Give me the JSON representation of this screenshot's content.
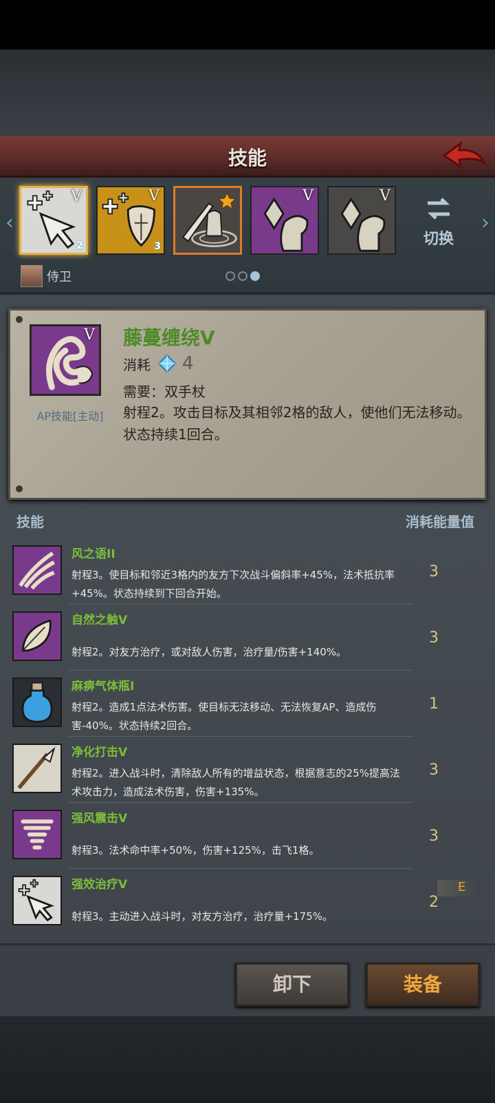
{
  "header": {
    "title": "技能"
  },
  "skillbar": {
    "slots": [
      {
        "roman": "V",
        "level": "2"
      },
      {
        "roman": "V",
        "level": "3"
      },
      {
        "roman": ""
      },
      {
        "roman": "V"
      },
      {
        "roman": "V"
      }
    ],
    "switch_label": "切换",
    "guard_label": "侍卫"
  },
  "detail": {
    "name": "藤蔓缠绕V",
    "roman": "V",
    "type": "AP技能[主动]",
    "cost_label": "消耗",
    "cost_value": "4",
    "requirement": "需要：双手杖",
    "description": "射程2。攻击目标及其相邻2格的敌人，使他们无法移动。状态持续1回合。"
  },
  "list": {
    "header_skill": "技能",
    "header_cost": "消耗能量值",
    "items": [
      {
        "name": "风之语II",
        "desc": "射程3。使目标和邻近3格内的友方下次战斗偏斜率+45%，法术抵抗率+45%。状态持续到下回合开始。",
        "cost": "3"
      },
      {
        "name": "自然之触V",
        "desc": "射程2。对友方治疗，或对敌人伤害，治疗量/伤害+140%。",
        "cost": "3"
      },
      {
        "name": "麻痹气体瓶I",
        "desc": "射程2。造成1点法术伤害。使目标无法移动、无法恢复AP、造成伤害-40%。状态持续2回合。",
        "cost": "1"
      },
      {
        "name": "净化打击V",
        "desc": "射程2。进入战斗时，清除敌人所有的增益状态，根据意志的25%提高法术攻击力，造成法术伤害，伤害+135%。",
        "cost": "3"
      },
      {
        "name": "强风震击V",
        "desc": "射程3。法术命中率+50%，伤害+125%，击飞1格。",
        "cost": "3"
      },
      {
        "name": "强效治疗V",
        "desc": "射程3。主动进入战斗时，对友方治疗，治疗量+175%。",
        "cost": "2"
      }
    ],
    "equipped_mark": "E"
  },
  "footer": {
    "unload_label": "卸下",
    "equip_label": "装备"
  },
  "colors": {
    "accent_gold": "#e8b040",
    "skill_name_green": "#7cbd3a",
    "equip_orange": "#f0a83a"
  }
}
